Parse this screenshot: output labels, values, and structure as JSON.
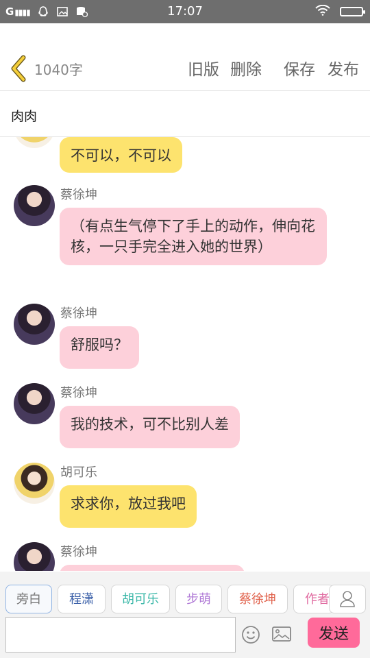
{
  "status_bar": {
    "signal": "G",
    "time": "17:07",
    "icons": [
      "signal-icon",
      "qq-icon",
      "photo-icon",
      "storage-icon",
      "wifi-icon",
      "battery-icon"
    ]
  },
  "header": {
    "word_count": "1040字",
    "actions": {
      "old": "旧版",
      "delete": "删除",
      "save": "保存",
      "publish": "发布"
    }
  },
  "title": "肉肉",
  "messages": [
    {
      "speaker": "",
      "text": "不可以，不可以",
      "color": "#fde36e"
    },
    {
      "speaker": "蔡徐坤",
      "text": "（有点生气停下了手上的动作，伸向花核，一只手完全进入她的世界）",
      "color": "#fdd0da"
    },
    {
      "speaker": "蔡徐坤",
      "text": "舒服吗？",
      "color": "#fdd0da"
    },
    {
      "speaker": "蔡徐坤",
      "text": "我的技术，可不比别人差",
      "color": "#fdd0da"
    },
    {
      "speaker": "胡可乐",
      "text": "求求你，放过我吧",
      "color": "#fde36e"
    },
    {
      "speaker": "蔡徐坤",
      "text": "",
      "color": "#fdd0da"
    }
  ],
  "roles": [
    {
      "label": "旁白",
      "color": "#777777"
    },
    {
      "label": "程潇",
      "color": "#3a5fa8"
    },
    {
      "label": "胡可乐",
      "color": "#3ab7a8"
    },
    {
      "label": "步萌",
      "color": "#b07ad6"
    },
    {
      "label": "蔡徐坤",
      "color": "#e0604a"
    },
    {
      "label": "作者",
      "color": "#e06aa0"
    }
  ],
  "input": {
    "value": "",
    "placeholder": ""
  },
  "send_label": "发送",
  "colors": {
    "accent": "#ff6a9a",
    "pink_bubble": "#fdd0da",
    "yellow_bubble": "#fde36e",
    "status_bar": "#6e6e6e"
  }
}
